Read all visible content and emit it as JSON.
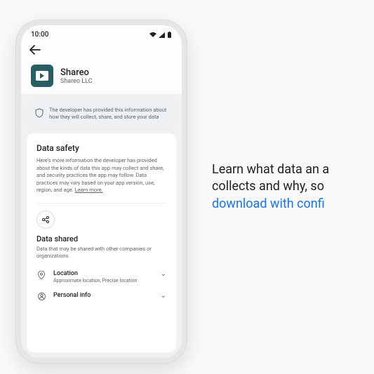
{
  "status": {
    "time": "10:00"
  },
  "app": {
    "name": "Shareo",
    "publisher": "Shareo LLC"
  },
  "notice": {
    "text": "The developer has provided this information about how they will collect, share, and store your data"
  },
  "safety": {
    "title": "Data safety",
    "description": "Here's more information the developer has provided about the kinds of data this app may collect and share, and security practices the app may follow. Data practices may vary based on your app version, use, region, and age.",
    "learn_more": "Learn more."
  },
  "shared": {
    "title": "Data shared",
    "subtitle": "Data that may be shared with other companies or organizations",
    "items": [
      {
        "label": "Location",
        "detail": "Approximate location, Precise location"
      },
      {
        "label": "Personal info",
        "detail": ""
      }
    ]
  },
  "promo": {
    "line1": "Learn what data an a",
    "line2": "collects and why, so",
    "line3": "download with confi"
  }
}
